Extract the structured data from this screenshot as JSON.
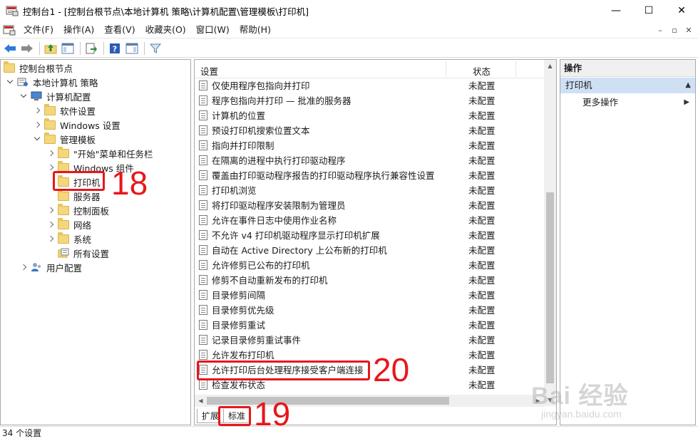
{
  "window": {
    "title": "控制台1 - [控制台根节点\\本地计算机 策略\\计算机配置\\管理模板\\打印机]",
    "minimize": "—",
    "maximize": "☐",
    "close": "✕"
  },
  "menu": {
    "items": [
      "文件(F)",
      "操作(A)",
      "查看(V)",
      "收藏夹(O)",
      "窗口(W)",
      "帮助(H)"
    ],
    "mdi": [
      "–",
      "▫",
      "✕"
    ]
  },
  "toolbar": {
    "icons": [
      "back-arrow-icon",
      "forward-arrow-icon",
      "up-folder-icon",
      "show-hide-tree-icon",
      "export-list-icon",
      "help-icon",
      "show-hide-action-pane-icon",
      "filter-icon"
    ]
  },
  "tree": {
    "root": "控制台根节点",
    "policy": "本地计算机 策略",
    "computer_config": "计算机配置",
    "software_settings": "软件设置",
    "windows_settings": "Windows 设置",
    "admin_templates": "管理模板",
    "start_menu": "\"开始\"菜单和任务栏",
    "windows_components": "Windows 组件",
    "printers": "打印机",
    "servers": "服务器",
    "control_panel": "控制面板",
    "network": "网络",
    "system": "系统",
    "all_settings": "所有设置",
    "user_config": "用户配置"
  },
  "annotations": {
    "n18": "18",
    "n19": "19",
    "n20": "20"
  },
  "list": {
    "col_setting": "设置",
    "col_state": "状态",
    "rows": [
      {
        "name": "仅使用程序包指向并打印",
        "state": "未配置"
      },
      {
        "name": "程序包指向并打印 — 批准的服务器",
        "state": "未配置"
      },
      {
        "name": "计算机的位置",
        "state": "未配置"
      },
      {
        "name": "预设打印机搜索位置文本",
        "state": "未配置"
      },
      {
        "name": "指向并打印限制",
        "state": "未配置"
      },
      {
        "name": "在隔离的进程中执行打印驱动程序",
        "state": "未配置"
      },
      {
        "name": "覆盖由打印驱动程序报告的打印驱动程序执行兼容性设置",
        "state": "未配置"
      },
      {
        "name": "打印机浏览",
        "state": "未配置"
      },
      {
        "name": "将打印驱动程序安装限制为管理员",
        "state": "未配置"
      },
      {
        "name": "允许在事件日志中使用作业名称",
        "state": "未配置"
      },
      {
        "name": "不允许 v4 打印机驱动程序显示打印机扩展",
        "state": "未配置"
      },
      {
        "name": "自动在 Active Directory 上公布新的打印机",
        "state": "未配置"
      },
      {
        "name": "允许修剪已公布的打印机",
        "state": "未配置"
      },
      {
        "name": "修剪不自动重新发布的打印机",
        "state": "未配置"
      },
      {
        "name": "目录修剪间隔",
        "state": "未配置"
      },
      {
        "name": "目录修剪优先级",
        "state": "未配置"
      },
      {
        "name": "目录修剪重试",
        "state": "未配置"
      },
      {
        "name": "记录目录修剪重试事件",
        "state": "未配置"
      },
      {
        "name": "允许发布打印机",
        "state": "未配置"
      },
      {
        "name": "允许打印后台处理程序接受客户端连接",
        "state": "未配置"
      },
      {
        "name": "检查发布状态",
        "state": "未配置"
      }
    ],
    "tab_extended": "扩展",
    "tab_standard": "标准"
  },
  "actions": {
    "header": "操作",
    "section": "打印机",
    "more": "更多操作"
  },
  "status": {
    "text": "34 个设置"
  },
  "watermark": {
    "main": "Bai 经验",
    "sub": "jingyan.baidu.com"
  }
}
